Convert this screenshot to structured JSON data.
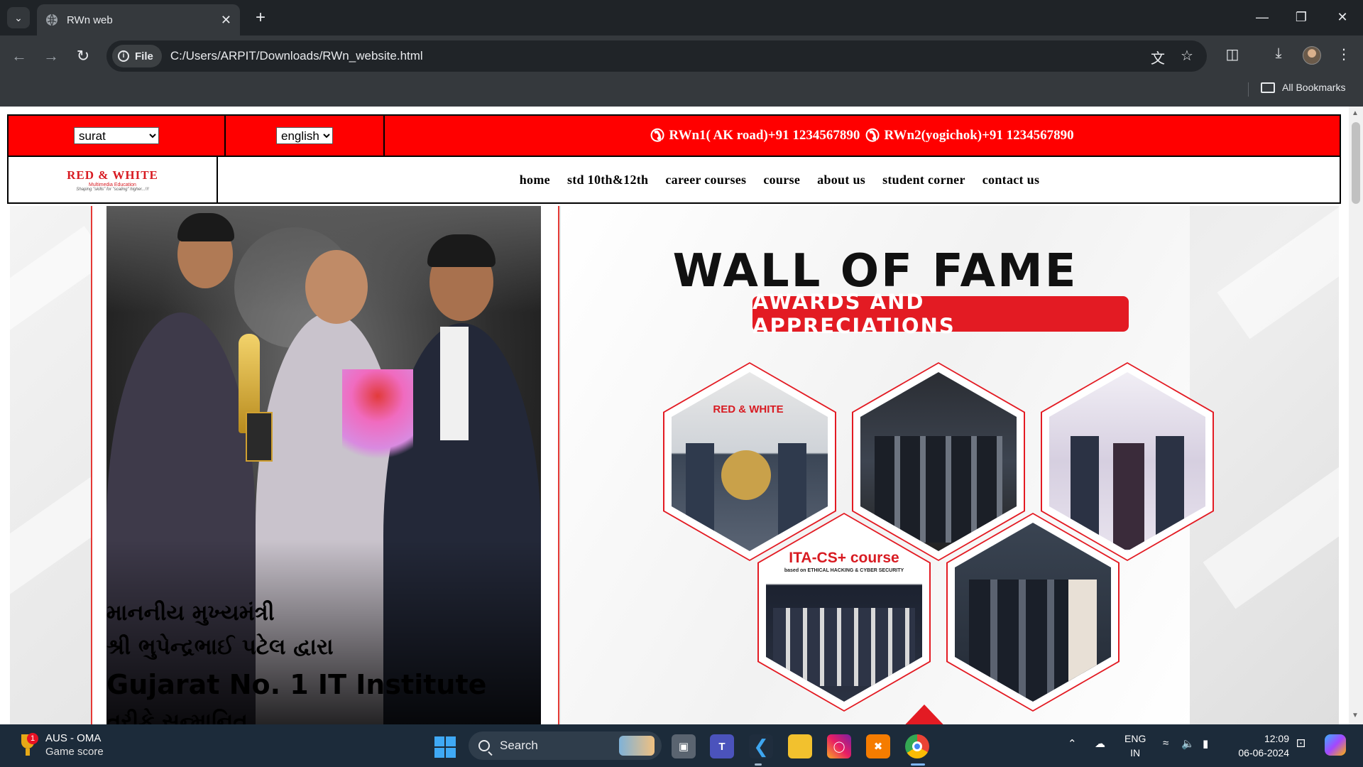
{
  "browser": {
    "tab_title": "RWn web",
    "chip_label": "File",
    "url": "C:/Users/ARPIT/Downloads/RWn_website.html",
    "bookmarks_label": "All Bookmarks"
  },
  "site": {
    "city_select": {
      "selected": "surat"
    },
    "lang_select": {
      "selected": "english"
    },
    "phones": [
      "RWn1( AK road)+91 1234567890",
      "RWn2(yogichok)+91 1234567890"
    ],
    "logo": {
      "title": "RED & WHITE",
      "subtitle": "Multimedia Education",
      "tagline": "Shaping \"skills\" for \"scaling\" higher...!!!"
    },
    "menu": [
      "home",
      "std 10th&12th",
      "career courses",
      "course",
      "about us",
      "student corner",
      "contact us"
    ]
  },
  "hero": {
    "caption_line1": "માનનીય મુખ્યમંત્રી",
    "caption_line2": "શ્રી ભુપેન્દ્રભાઈ પટેલ દ્વારા",
    "caption_line3": "Gujarat No. 1 IT Institute",
    "caption_line4": "તરીકે સન્માનિત",
    "fame_title": "WALL OF FAME",
    "fame_subtitle": "AWARDS AND APPRECIATIONS",
    "hex_labels": {
      "hex1": "RED & WHITE",
      "hex4_title": "ITA-CS+ course",
      "hex4_sub": "based on ETHICAL HACKING & CYBER SECURITY"
    }
  },
  "taskbar": {
    "weather_line1": "AUS - OMA",
    "weather_line2": "Game score",
    "weather_badge": "1",
    "search_placeholder": "Search",
    "lang_line1": "ENG",
    "lang_line2": "IN",
    "time": "12:09",
    "date": "06-06-2024"
  },
  "colors": {
    "brand_red": "#ff0000",
    "accent_red": "#e31b23",
    "chrome_dark": "#35393d",
    "taskbar": "#1c2b3a"
  },
  "icons": [
    "tab-menu-icon",
    "globe-icon",
    "close-icon",
    "plus-icon",
    "minimize-icon",
    "restore-icon",
    "back-icon",
    "forward-icon",
    "reload-icon",
    "info-icon",
    "translate-icon",
    "star-icon",
    "extensions-icon",
    "download-icon",
    "more-icon",
    "folder-icon",
    "phone-icon",
    "windows-icon",
    "search-icon",
    "wifi-icon",
    "speaker-icon",
    "battery-icon",
    "bell-icon"
  ]
}
